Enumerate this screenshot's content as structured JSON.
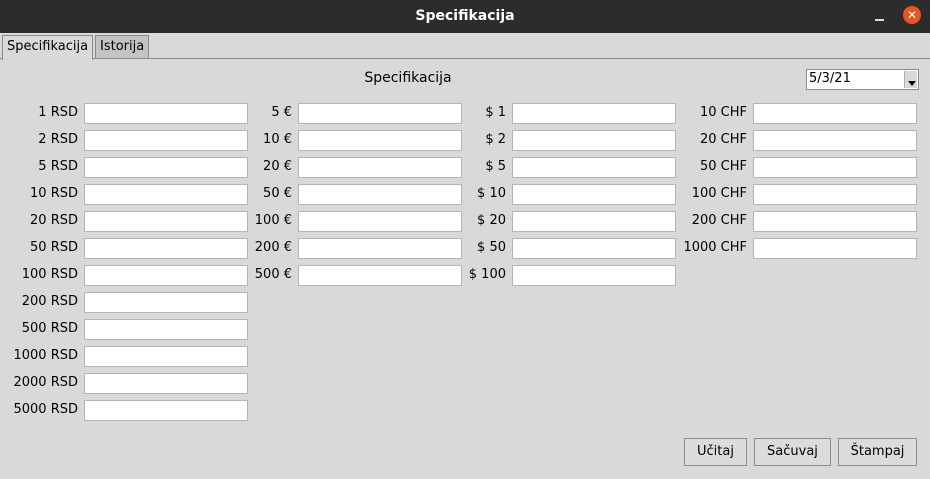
{
  "window": {
    "title": "Specifikacija",
    "close_glyph": "✕"
  },
  "tabs": [
    "Specifikacija",
    "Istorija"
  ],
  "heading": "Specifikacija",
  "date": "5/3/21",
  "rsd_labels": [
    "1 RSD",
    "2 RSD",
    "5 RSD",
    "10 RSD",
    "20 RSD",
    "50 RSD",
    "100 RSD",
    "200 RSD",
    "500 RSD",
    "1000 RSD",
    "2000 RSD",
    "5000 RSD"
  ],
  "eur_labels": [
    "5 €",
    "10 €",
    "20 €",
    "50 €",
    "100 €",
    "200 €",
    "500 €"
  ],
  "usd_labels": [
    "$ 1",
    "$ 2",
    "$ 5",
    "$ 10",
    "$ 20",
    "$ 50",
    "$ 100"
  ],
  "chf_labels": [
    "10 CHF",
    "20 CHF",
    "50 CHF",
    "100 CHF",
    "200 CHF",
    "1000 CHF"
  ],
  "buttons": {
    "load": "Učitaj",
    "save": "Sačuvaj",
    "print": "Štampaj"
  }
}
